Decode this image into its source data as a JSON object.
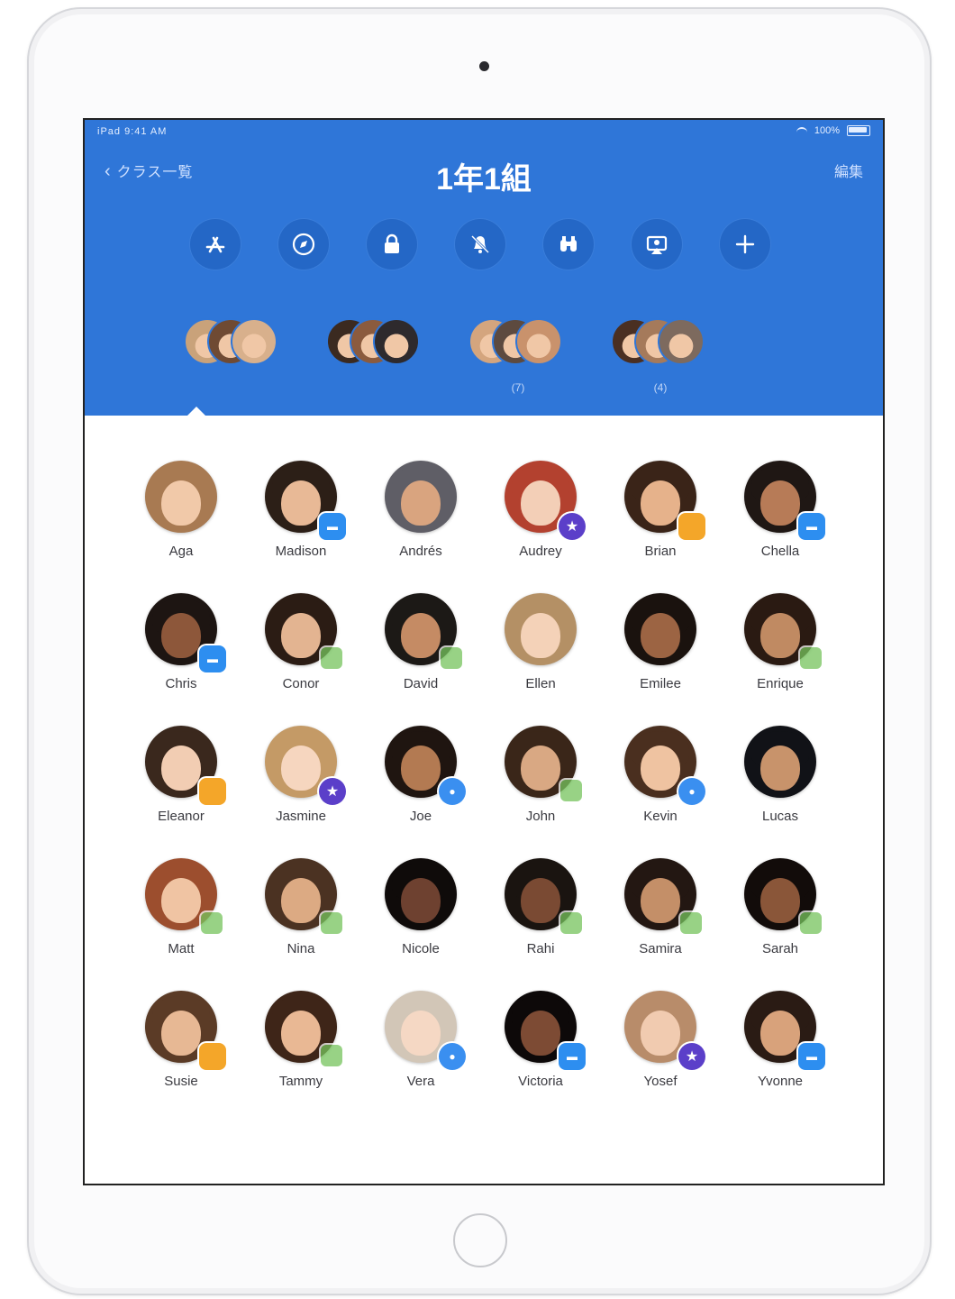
{
  "device": {
    "camera": "front-camera",
    "home_button": "home-button"
  },
  "status_bar": {
    "left": "iPad 9:41 AM",
    "right": "100%"
  },
  "nav": {
    "back_label": "クラス一覧",
    "title": "1年1組",
    "edit_label": "編集"
  },
  "toolbar": [
    {
      "icon": "app-store-icon"
    },
    {
      "icon": "safari-icon"
    },
    {
      "icon": "lock-icon"
    },
    {
      "icon": "mute-icon"
    },
    {
      "icon": "binoculars-icon"
    },
    {
      "icon": "airplay-icon"
    },
    {
      "icon": "add-icon"
    }
  ],
  "groups": [
    {
      "label": "",
      "selected": true
    },
    {
      "label": ""
    },
    {
      "label": "(7)"
    },
    {
      "label": "(4)"
    }
  ],
  "students": [
    {
      "name": "Aga",
      "badge": "none",
      "hair": "#a87a52",
      "skin": "#f1c9a9"
    },
    {
      "name": "Madison",
      "badge": "blue",
      "hair": "#2c1f17",
      "skin": "#e8b996"
    },
    {
      "name": "Andrés",
      "badge": "none",
      "hair": "#5f5e66",
      "skin": "#d9a47f"
    },
    {
      "name": "Audrey",
      "badge": "star",
      "hair": "#b3412f",
      "skin": "#f3cfb7"
    },
    {
      "name": "Brian",
      "badge": "orange",
      "hair": "#3a2418",
      "skin": "#e6b28b"
    },
    {
      "name": "Chella",
      "badge": "blue",
      "hair": "#1f1714",
      "skin": "#b77b57"
    },
    {
      "name": "Chris",
      "badge": "blue",
      "hair": "#1d1512",
      "skin": "#8d573a"
    },
    {
      "name": "Conor",
      "badge": "green",
      "hair": "#2b1c14",
      "skin": "#e3b491"
    },
    {
      "name": "David",
      "badge": "green",
      "hair": "#1c1916",
      "skin": "#c58b64"
    },
    {
      "name": "Ellen",
      "badge": "none",
      "hair": "#b49065",
      "skin": "#f4d2b8"
    },
    {
      "name": "Emilee",
      "badge": "none",
      "hair": "#1a120e",
      "skin": "#9c6443"
    },
    {
      "name": "Enrique",
      "badge": "green",
      "hair": "#2a1a12",
      "skin": "#c08a62"
    },
    {
      "name": "Eleanor",
      "badge": "orange",
      "hair": "#3a281d",
      "skin": "#f2cdb3"
    },
    {
      "name": "Jasmine",
      "badge": "star",
      "hair": "#c49a66",
      "skin": "#f6d6bf"
    },
    {
      "name": "Joe",
      "badge": "bubble",
      "hair": "#1f1510",
      "skin": "#b37a52"
    },
    {
      "name": "John",
      "badge": "green",
      "hair": "#3a2619",
      "skin": "#d9a883"
    },
    {
      "name": "Kevin",
      "badge": "bubble",
      "hair": "#4a2f1f",
      "skin": "#efc3a1"
    },
    {
      "name": "Lucas",
      "badge": "none",
      "hair": "#111217",
      "skin": "#c8936b"
    },
    {
      "name": "Matt",
      "badge": "green",
      "hair": "#9c4e2e",
      "skin": "#f0c4a3"
    },
    {
      "name": "Nina",
      "badge": "green",
      "hair": "#4b3222",
      "skin": "#dcaa83"
    },
    {
      "name": "Nicole",
      "badge": "none",
      "hair": "#0f0b0a",
      "skin": "#6e4130"
    },
    {
      "name": "Rahi",
      "badge": "green",
      "hair": "#1a1410",
      "skin": "#7a4a33"
    },
    {
      "name": "Samira",
      "badge": "green",
      "hair": "#231712",
      "skin": "#c48f68"
    },
    {
      "name": "Sarah",
      "badge": "green",
      "hair": "#120c0a",
      "skin": "#8a5639"
    },
    {
      "name": "Susie",
      "badge": "orange",
      "hair": "#5b3b26",
      "skin": "#e7b894"
    },
    {
      "name": "Tammy",
      "badge": "green",
      "hair": "#3e2518",
      "skin": "#e9b894"
    },
    {
      "name": "Vera",
      "badge": "bubble",
      "hair": "#d2c6b7",
      "skin": "#f5d8c4"
    },
    {
      "name": "Victoria",
      "badge": "blue",
      "hair": "#0d0909",
      "skin": "#7d4b34"
    },
    {
      "name": "Yosef",
      "badge": "star",
      "hair": "#b88c6a",
      "skin": "#f1cbb0"
    },
    {
      "name": "Yvonne",
      "badge": "blue",
      "hair": "#2a1b14",
      "skin": "#d8a27b"
    }
  ],
  "colors": {
    "header": "#2f76d8",
    "tool_circle": "#2467c6",
    "star_badge": "#5b3fc9",
    "orange_badge": "#f4a629",
    "blue_badge": "#2d8ef0",
    "green_badge": "#76c45d"
  }
}
